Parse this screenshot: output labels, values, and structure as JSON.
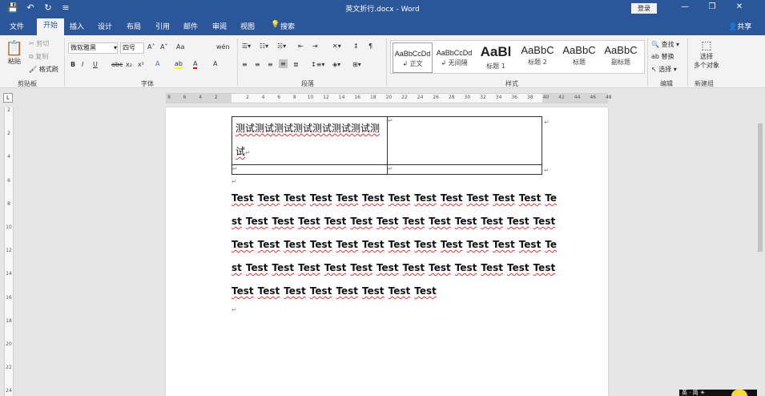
{
  "titlebar": {
    "title": "英文折行.docx  -  Word",
    "login": "登录",
    "icons": {
      "save": "💾",
      "undo": "↶",
      "redo": "↻",
      "customize": "≡"
    },
    "min": "—",
    "restore": "❐",
    "close": "✕"
  },
  "tabs": {
    "file": "文件",
    "home": "开始",
    "insert": "插入",
    "design": "设计",
    "layout": "布局",
    "references": "引用",
    "mailings": "邮件",
    "review": "审阅",
    "view": "视图",
    "search": "搜索",
    "share": "共享"
  },
  "clipboard": {
    "paste": "粘贴",
    "cut": "剪切",
    "copy": "复制",
    "format_painter": "格式刷",
    "label": "剪贴板"
  },
  "font": {
    "name": "微软雅黑",
    "size": "四号",
    "label": "字体",
    "bold": "B",
    "italic": "I",
    "underline": "U",
    "strike": "abc",
    "sub": "x₂",
    "sup": "x²",
    "grow": "A˄",
    "shrink": "A˅",
    "case": "Aa",
    "clear": "A",
    "color": "A",
    "highlight": "ab",
    "phonetic": "wén",
    "border": "A"
  },
  "paragraph": {
    "label": "段落"
  },
  "styles": {
    "label": "样式",
    "items": [
      {
        "preview": "AaBbCcDd",
        "name": "↲ 正文"
      },
      {
        "preview": "AaBbCcDd",
        "name": "↲ 无间隔"
      },
      {
        "preview": "AaBl",
        "name": "标题 1"
      },
      {
        "preview": "AaBbC",
        "name": "标题 2"
      },
      {
        "preview": "AaBbC",
        "name": "标题"
      },
      {
        "preview": "AaBbC",
        "name": "副标题"
      }
    ]
  },
  "editing": {
    "find": "查找",
    "replace": "替换",
    "select": "选择",
    "label": "编辑"
  },
  "newgroup": {
    "select_objects_1": "选择",
    "select_objects_2": "多个对象",
    "label": "新建组"
  },
  "ruler": {
    "h_numbers": [
      "8",
      "6",
      "4",
      "2",
      "",
      "2",
      "4",
      "6",
      "8",
      "10",
      "12",
      "14",
      "16",
      "18",
      "20",
      "22",
      "24",
      "26",
      "28",
      "30",
      "32",
      "34",
      "36",
      "38",
      "40",
      "42",
      "44",
      "46",
      "48"
    ],
    "v_numbers": [
      "2",
      "",
      "2",
      "",
      "4",
      "",
      "6",
      "",
      "8",
      "",
      "10",
      "",
      "12",
      "",
      "14",
      "",
      "16",
      "",
      "18",
      "",
      "20",
      "",
      "22",
      "",
      "24"
    ]
  },
  "document": {
    "table": {
      "cell1": "测试测试测试测试测试测试测试测试",
      "mark": "↵"
    },
    "lines": [
      [
        "Test",
        "Test",
        "Test",
        "Test",
        "Test",
        "Test",
        "Test",
        "Test",
        "Test",
        "Test",
        "Test",
        "Test",
        "Te"
      ],
      [
        "st",
        "Test",
        "Test",
        "Test",
        "Test",
        "Test",
        "Test",
        "Test",
        "Test",
        "Test",
        "Test",
        "Test",
        "Test"
      ],
      [
        "Test",
        "Test",
        "Test",
        "Test",
        "Test",
        "Test",
        "Test",
        "Test",
        "Test",
        "Test",
        "Test",
        "Test",
        "Te"
      ],
      [
        "st",
        "Test",
        "Test",
        "Test",
        "Test",
        "Test",
        "Test",
        "Test",
        "Test",
        "Test",
        "Test",
        "Test",
        "Test"
      ],
      [
        "Test",
        "Test",
        "Test",
        "Test",
        "Test",
        "Test",
        "Test",
        "Test"
      ]
    ],
    "para_mark": "↵"
  },
  "ime": {
    "text": "英 · 简 ☀"
  }
}
